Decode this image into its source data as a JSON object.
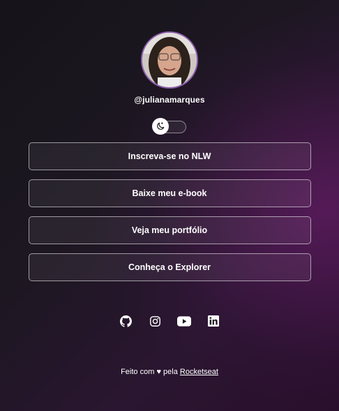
{
  "profile": {
    "username": "@julianamarques"
  },
  "theme_switch": {
    "icon": "moon-icon"
  },
  "links": [
    {
      "label": "Inscreva-se no NLW"
    },
    {
      "label": "Baixe meu e-book"
    },
    {
      "label": "Veja meu portfólio"
    },
    {
      "label": "Conheça o Explorer"
    }
  ],
  "social": [
    {
      "icon": "github-icon"
    },
    {
      "icon": "instagram-icon"
    },
    {
      "icon": "youtube-icon"
    },
    {
      "icon": "linkedin-icon"
    }
  ],
  "footer": {
    "prefix": "Feito com",
    "heart": "♥",
    "middle": "pela",
    "link_text": "Rocketseat"
  }
}
